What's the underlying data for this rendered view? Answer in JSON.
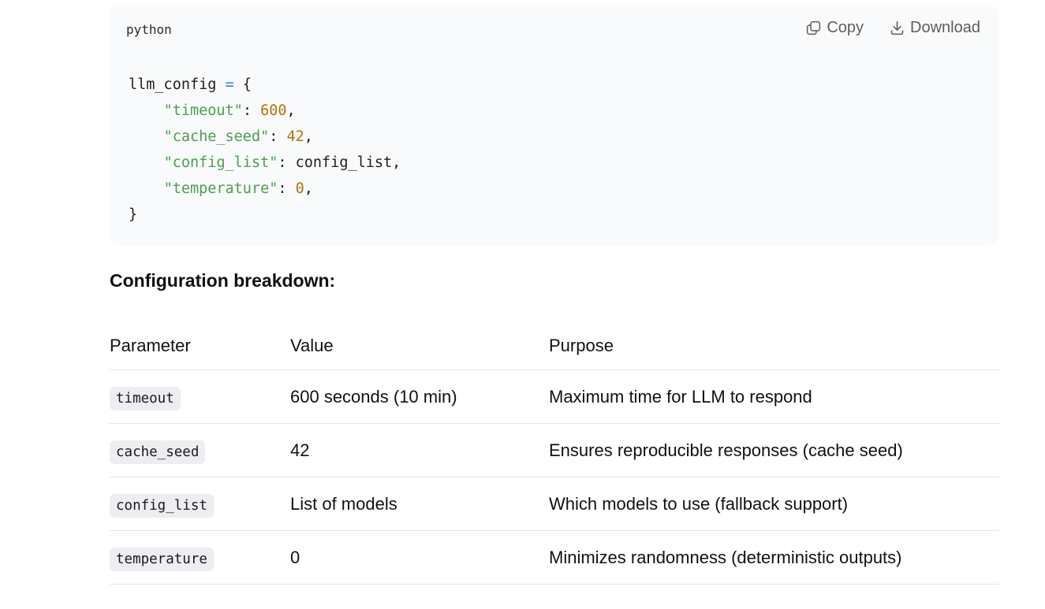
{
  "code_block": {
    "language": "python",
    "copy_label": "Copy",
    "download_label": "Download",
    "lines": [
      {
        "tokens": [
          {
            "t": "llm_config ",
            "c": "plain"
          },
          {
            "t": "=",
            "c": "op"
          },
          {
            "t": " {",
            "c": "plain"
          }
        ]
      },
      {
        "tokens": [
          {
            "t": "    ",
            "c": "plain"
          },
          {
            "t": "\"timeout\"",
            "c": "str"
          },
          {
            "t": ": ",
            "c": "plain"
          },
          {
            "t": "600",
            "c": "num"
          },
          {
            "t": ",",
            "c": "plain"
          }
        ]
      },
      {
        "tokens": [
          {
            "t": "    ",
            "c": "plain"
          },
          {
            "t": "\"cache_seed\"",
            "c": "str"
          },
          {
            "t": ": ",
            "c": "plain"
          },
          {
            "t": "42",
            "c": "num"
          },
          {
            "t": ",",
            "c": "plain"
          }
        ]
      },
      {
        "tokens": [
          {
            "t": "    ",
            "c": "plain"
          },
          {
            "t": "\"config_list\"",
            "c": "str"
          },
          {
            "t": ": config_list,",
            "c": "plain"
          }
        ]
      },
      {
        "tokens": [
          {
            "t": "    ",
            "c": "plain"
          },
          {
            "t": "\"temperature\"",
            "c": "str"
          },
          {
            "t": ": ",
            "c": "plain"
          },
          {
            "t": "0",
            "c": "num"
          },
          {
            "t": ",",
            "c": "plain"
          }
        ]
      },
      {
        "tokens": [
          {
            "t": "}",
            "c": "plain"
          }
        ]
      }
    ]
  },
  "section_title": "Configuration breakdown:",
  "table": {
    "headers": {
      "parameter": "Parameter",
      "value": "Value",
      "purpose": "Purpose"
    },
    "rows": [
      {
        "parameter": "timeout",
        "value": "600 seconds (10 min)",
        "purpose": "Maximum time for LLM to respond"
      },
      {
        "parameter": "cache_seed",
        "value": "42",
        "purpose": "Ensures reproducible responses (cache seed)"
      },
      {
        "parameter": "config_list",
        "value": "List of models",
        "purpose": "Which models to use (fallback support)"
      },
      {
        "parameter": "temperature",
        "value": "0",
        "purpose": "Minimizes randomness (deterministic outputs)"
      }
    ]
  },
  "colors": {
    "code_background": "#f9fafb",
    "string": "#4b9e4f",
    "number": "#b5700c",
    "operator": "#3a7bd5"
  },
  "icons": {
    "copy": "copy-icon",
    "download": "download-icon"
  }
}
